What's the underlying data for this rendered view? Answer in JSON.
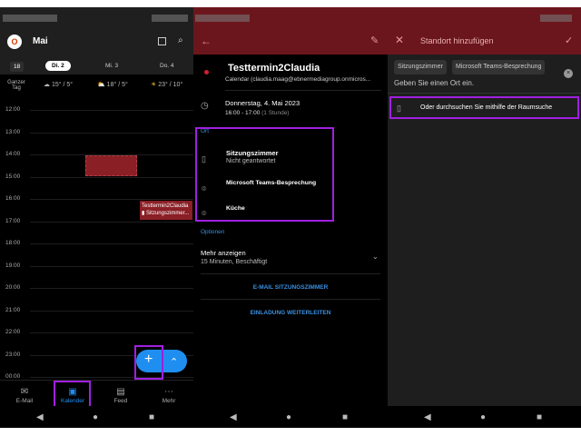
{
  "calendar": {
    "month": "Mai",
    "days": [
      "18",
      "Di. 2",
      "Mi. 3",
      "Do. 4"
    ],
    "all_day_label": "Ganzer Tag",
    "weather": [
      {
        "icon": "cloud-icon",
        "text": "15° / 5°"
      },
      {
        "icon": "partly-sunny-icon",
        "text": "18° / 5°"
      },
      {
        "icon": "sun-icon",
        "text": "23° / 10°"
      }
    ],
    "hours": [
      "12:00",
      "13:00",
      "14:00",
      "15:00",
      "16:00",
      "17:00",
      "18:00",
      "19:00",
      "20:00",
      "21:00",
      "22:00",
      "23:00",
      "00:00"
    ],
    "event": {
      "title": "Testtermin2Claudia",
      "location": "Sitzungszimmer..."
    },
    "nav": [
      {
        "label": "E-Mail",
        "icon": "✉"
      },
      {
        "label": "Kalender",
        "icon": "▣"
      },
      {
        "label": "Feed",
        "icon": "▤"
      },
      {
        "label": "Mehr",
        "icon": "⋯"
      }
    ],
    "fab": "+",
    "fab_secondary": "⌃"
  },
  "details": {
    "title": "Testtermin2Claudia",
    "calendar": "Calendar (claudia.maag@ebnermediagroup.onmicros...",
    "date": "Donnerstag, 4. Mai 2023",
    "time": "16:00 - 17:00",
    "duration": "(1 Stunde)",
    "location_header": "Ort",
    "locations": [
      {
        "name": "Sitzungszimmer",
        "status": "Nicht geantwortet"
      },
      {
        "name": "Microsoft Teams-Besprechung"
      },
      {
        "name": "Küche"
      }
    ],
    "options_header": "Optionen",
    "more": "Mehr anzeigen",
    "more_sub": "15 Minuten, Beschäftigt",
    "email_room": "E-MAIL SITZUNGSZIMMER",
    "forward": "EINLADUNG WEITERLEITEN"
  },
  "location": {
    "title": "Standort hinzufügen",
    "chips": [
      "Sitzungszimmer",
      "Microsoft Teams-Besprechung"
    ],
    "placeholder": "Geben Sie einen Ort ein.",
    "room_search": "Oder durchsuchen Sie mithilfe der Raumsuche"
  },
  "colors": {
    "accent": "#1f8ef1",
    "header_red": "#6b161c",
    "highlight": "#a020e0"
  }
}
